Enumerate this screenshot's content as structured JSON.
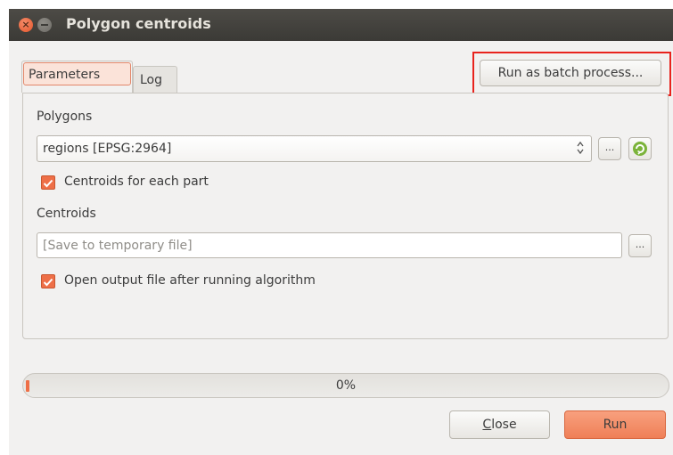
{
  "window": {
    "title": "Polygon centroids",
    "close_glyph": "×"
  },
  "tabs": [
    {
      "label": "Parameters",
      "active": true
    },
    {
      "label": "Log",
      "active": false
    }
  ],
  "batch_button": {
    "label": "Run as batch process..."
  },
  "form": {
    "polygons_label": "Polygons",
    "polygons_value": "regions [EPSG:2964]",
    "browse_label": "...",
    "centroids_each_part": {
      "label": "Centroids for each part",
      "checked": true
    },
    "centroids_label": "Centroids",
    "output_placeholder": "[Save to temporary file]",
    "open_output": {
      "label": "Open output file after running algorithm",
      "checked": true
    }
  },
  "progress": {
    "value": 0,
    "text": "0%"
  },
  "footer": {
    "close_accel": "C",
    "close_rest": "lose",
    "run_label": "Run"
  },
  "colors": {
    "accent": "#ee6f47",
    "highlight_box": "#e8231d",
    "titlebar": "#3c3b37"
  },
  "icons": [
    "window-close-icon",
    "window-minimize-icon",
    "spinner-arrows-icon",
    "iterate-icon",
    "checkmark-icon"
  ]
}
